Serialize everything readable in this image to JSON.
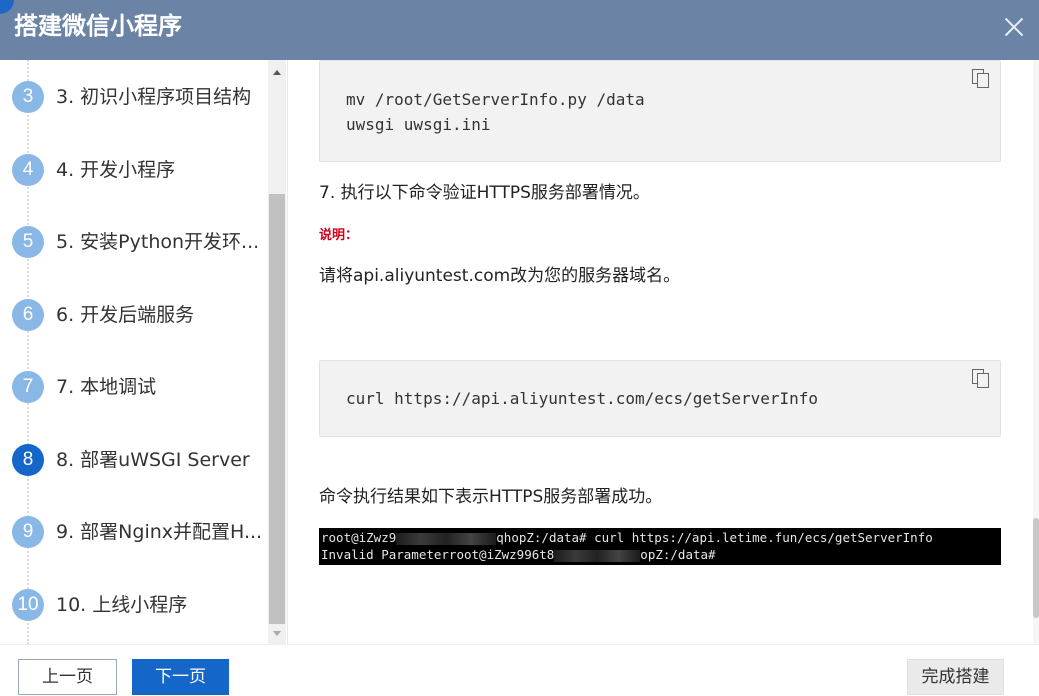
{
  "dialog": {
    "title": "搭建微信小程序"
  },
  "steps": [
    {
      "num": "3",
      "label": "3. 初识小程序项目结构",
      "active": false
    },
    {
      "num": "4",
      "label": "4. 开发小程序",
      "active": false
    },
    {
      "num": "5",
      "label": "5. 安装Python开发环...",
      "active": false
    },
    {
      "num": "6",
      "label": "6. 开发后端服务",
      "active": false
    },
    {
      "num": "7",
      "label": "7. 本地调试",
      "active": false
    },
    {
      "num": "8",
      "label": "8. 部署uWSGI Server",
      "active": true
    },
    {
      "num": "9",
      "label": "9. 部署Nginx并配置H...",
      "active": false
    },
    {
      "num": "10",
      "label": "10. 上线小程序",
      "active": false
    }
  ],
  "content": {
    "code1": {
      "line1": "mv /root/GetServerInfo.py /data",
      "line2": "uwsgi uwsgi.ini"
    },
    "step7": "7.  执行以下命令验证HTTPS服务部署情况。",
    "note_label": "说明：",
    "note_text": "请将api.aliyuntest.com改为您的服务器域名。",
    "code2": {
      "line1": "curl https://api.aliyuntest.com/ecs/getServerInfo"
    },
    "result_text": "命令执行结果如下表示HTTPS服务部署成功。",
    "terminal": {
      "line1_prefix": "root@iZwz9",
      "line1_suffix": "qhopZ:/data# curl https://api.letime.fun/ecs/getServerInfo",
      "line2_prefix": "Invalid Parameterroot@iZwz996t8",
      "line2_suffix": "opZ:/data#"
    }
  },
  "footer": {
    "prev_label": "上一页",
    "next_label": "下一页",
    "finish_label": "完成搭建"
  },
  "colors": {
    "header_bg": "#6b84a6",
    "primary": "#1467c8",
    "step_inactive": "#8ab8e6",
    "note_red": "#d0021b"
  },
  "icons": [
    "close-icon",
    "copy-icon",
    "scroll-up-arrow",
    "scroll-down-arrow"
  ]
}
